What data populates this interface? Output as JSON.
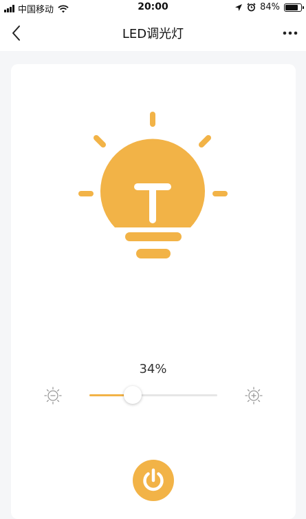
{
  "status_bar": {
    "carrier": "中国移动",
    "time": "20:00",
    "battery": "84%",
    "battery_level": 0.84
  },
  "nav": {
    "title": "LED调光灯",
    "back_icon": "chevron-left-icon",
    "more_icon": "more-dots-icon"
  },
  "bulb": {
    "icon": "light-bulb-icon",
    "color": "#f2b347"
  },
  "brightness": {
    "label": "34%",
    "value": 0.34,
    "decrease_icon": "brightness-decrease-icon",
    "increase_icon": "brightness-increase-icon"
  },
  "power": {
    "icon": "power-icon",
    "color": "#f2b347"
  }
}
